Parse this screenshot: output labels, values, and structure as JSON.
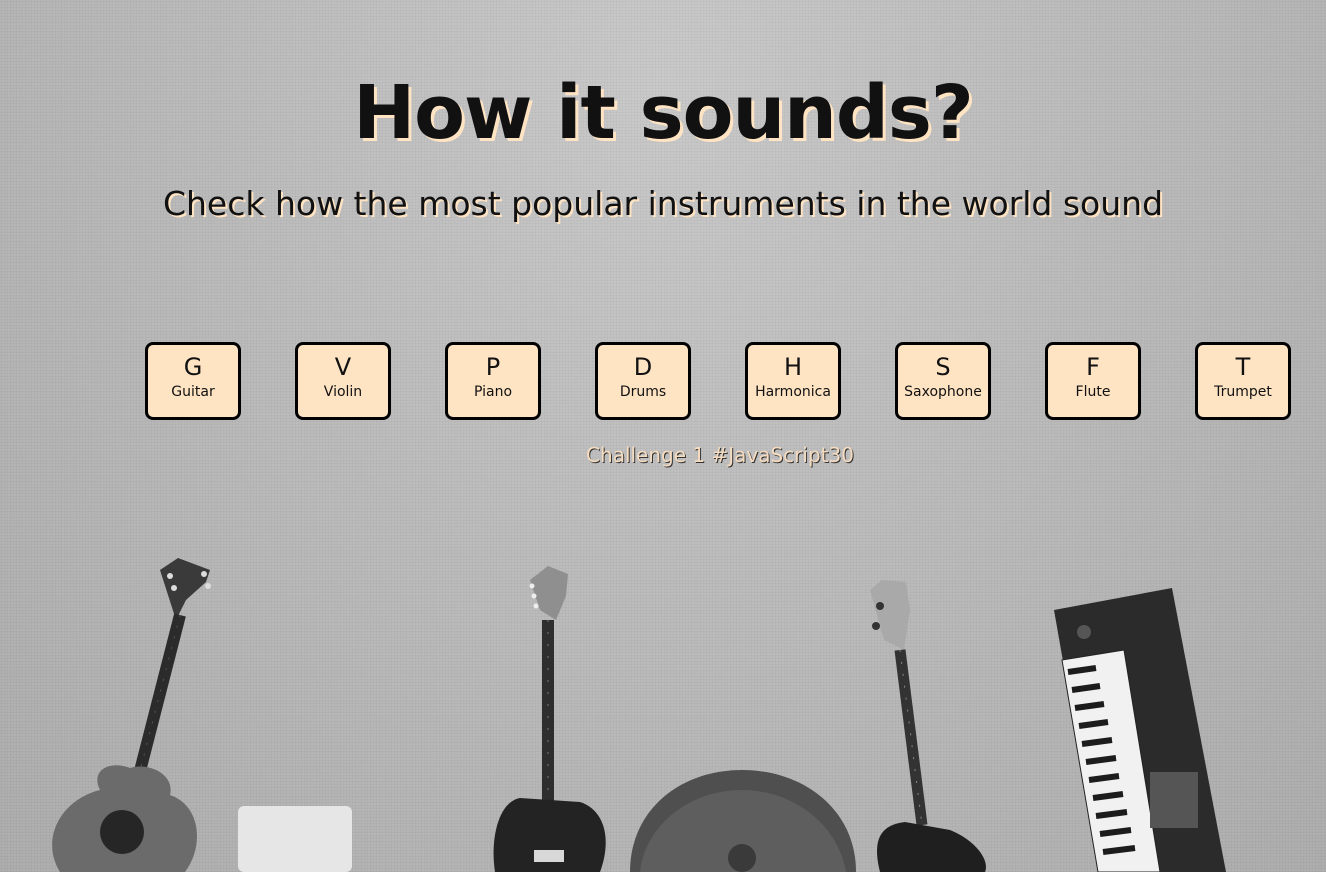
{
  "header": {
    "title": "How it sounds?",
    "subtitle": "Check how the most popular instruments in the world sound"
  },
  "keys": [
    {
      "letter": "G",
      "label": "Guitar"
    },
    {
      "letter": "V",
      "label": "Violin"
    },
    {
      "letter": "P",
      "label": "Piano"
    },
    {
      "letter": "D",
      "label": "Drums"
    },
    {
      "letter": "H",
      "label": "Harmonica"
    },
    {
      "letter": "S",
      "label": "Saxophone"
    },
    {
      "letter": "F",
      "label": "Flute"
    },
    {
      "letter": "T",
      "label": "Trumpet"
    }
  ],
  "footer": {
    "note": "Challenge 1 #JavaScript30"
  },
  "colors": {
    "key_background": "#ffe4c4",
    "key_border": "#000000",
    "text": "#111111",
    "footer_text": "#f5dcc0"
  },
  "background": {
    "icons": [
      "acoustic-guitar-icon",
      "electric-guitar-icon",
      "cymbal-icon",
      "bass-guitar-icon",
      "keyboard-icon"
    ]
  }
}
